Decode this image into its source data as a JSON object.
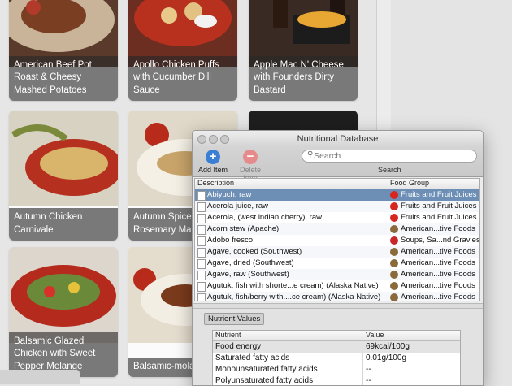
{
  "recipes": [
    {
      "title": "American Beef Pot Roast & Cheesy Mashed Potatoes"
    },
    {
      "title": "Apollo Chicken Puffs with Cucumber Dill Sauce"
    },
    {
      "title": "Apple Mac N' Cheese with Founders Dirty Bastard"
    },
    {
      "title": "Autumn Chicken Carnivale"
    },
    {
      "title": "Autumn Spiced with Rosemary Mashers"
    },
    {
      "title": "Balsamic Glazed Chicken with Sweet Pepper Melange"
    },
    {
      "title": "Balsamic-mola Chicken"
    }
  ],
  "window": {
    "title": "Nutritional Database",
    "toolbar": {
      "add_label": "Add Item",
      "delete_label": "Delete Item",
      "search_placeholder": "Search",
      "search_label": "Search"
    },
    "columns": {
      "description": "Description",
      "food_group": "Food Group"
    },
    "foods": [
      {
        "description": "Abiyuch, raw",
        "group": "Fruits and Fruit Juices",
        "icon": "apple-icon"
      },
      {
        "description": "Acerola juice, raw",
        "group": "Fruits and Fruit Juices",
        "icon": "apple-icon"
      },
      {
        "description": "Acerola, (west indian cherry), raw",
        "group": "Fruits and Fruit Juices",
        "icon": "apple-icon"
      },
      {
        "description": "Acorn stew (Apache)",
        "group": "American...tive Foods",
        "icon": "bowl-icon"
      },
      {
        "description": "Adobo fresco",
        "group": "Soups, Sa...nd Gravies",
        "icon": "soup-can-icon"
      },
      {
        "description": "Agave, cooked (Southwest)",
        "group": "American...tive Foods",
        "icon": "bowl-icon"
      },
      {
        "description": "Agave, dried (Southwest)",
        "group": "American...tive Foods",
        "icon": "bowl-icon"
      },
      {
        "description": "Agave, raw (Southwest)",
        "group": "American...tive Foods",
        "icon": "bowl-icon"
      },
      {
        "description": "Agutuk, fish with shorte...e cream) (Alaska Native)",
        "group": "American...tive Foods",
        "icon": "bowl-icon"
      },
      {
        "description": "Agutuk, fish/berry with....ce cream) (Alaska Native)",
        "group": "American...tive Foods",
        "icon": "bowl-icon"
      }
    ],
    "nutrient_panel": {
      "tab_label": "Nutrient Values",
      "columns": {
        "nutrient": "Nutrient",
        "value": "Value"
      },
      "rows": [
        {
          "nutrient": "Food energy",
          "value": "69kcal/100g"
        },
        {
          "nutrient": "Saturated fatty acids",
          "value": "0.01g/100g"
        },
        {
          "nutrient": "Monounsaturated fatty acids",
          "value": "--"
        },
        {
          "nutrient": "Polyunsaturated fatty acids",
          "value": "--"
        }
      ]
    }
  },
  "colors": {
    "selection": "#6d8fb6",
    "add_button": "#3b7fd4",
    "delete_button": "#e58b8b"
  }
}
